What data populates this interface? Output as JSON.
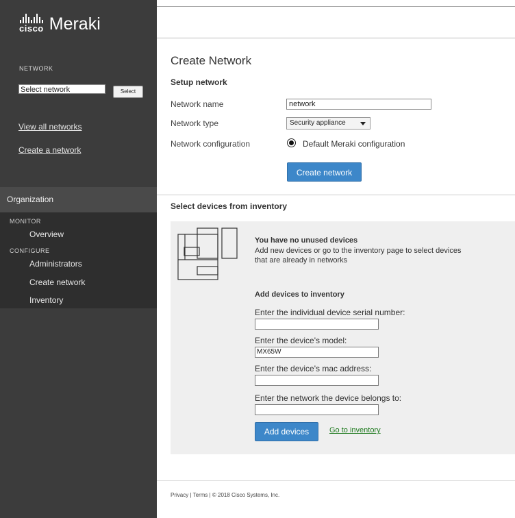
{
  "brand": {
    "cisco": "cisco",
    "product": "Meraki"
  },
  "sidebar": {
    "network_label": "NETWORK",
    "network_select_value": "Select network",
    "select_button": "Select",
    "links": [
      "View all networks",
      "Create a network"
    ],
    "organization": {
      "header": "Organization",
      "monitor_label": "MONITOR",
      "monitor_items": [
        "Overview"
      ],
      "configure_label": "CONFIGURE",
      "configure_items": [
        "Administrators",
        "Create network",
        "Inventory"
      ]
    }
  },
  "main": {
    "title": "Create Network",
    "setup_title": "Setup network",
    "form": {
      "name_label": "Network name",
      "name_value": "network",
      "type_label": "Network type",
      "type_value": "Security appliance",
      "config_label": "Network configuration",
      "config_option": "Default Meraki configuration",
      "create_button": "Create network"
    },
    "inventory": {
      "title": "Select devices from inventory",
      "no_devices_title": "You have no unused devices",
      "no_devices_text_1": "Add new devices or go to the inventory page to select devices",
      "no_devices_text_2": "that are already in networks",
      "add_title": "Add devices to inventory",
      "serial_label": "Enter the individual device serial number:",
      "serial_value": "",
      "model_label": "Enter the device's model:",
      "model_value": "MX65W",
      "mac_label": "Enter the device's mac address:",
      "mac_value": "",
      "network_label": "Enter the network the device belongs to:",
      "network_value": "",
      "add_button": "Add devices",
      "goto_link": "Go to inventory"
    }
  },
  "footer": {
    "text": "Privacy  |  Terms   |  © 2018 Cisco Systems, Inc."
  },
  "colors": {
    "sidebar": "#3c3c3c",
    "org_panel": "#2e2e2e",
    "primary_button": "#3d87c9",
    "link_green": "#1f7a1f"
  }
}
